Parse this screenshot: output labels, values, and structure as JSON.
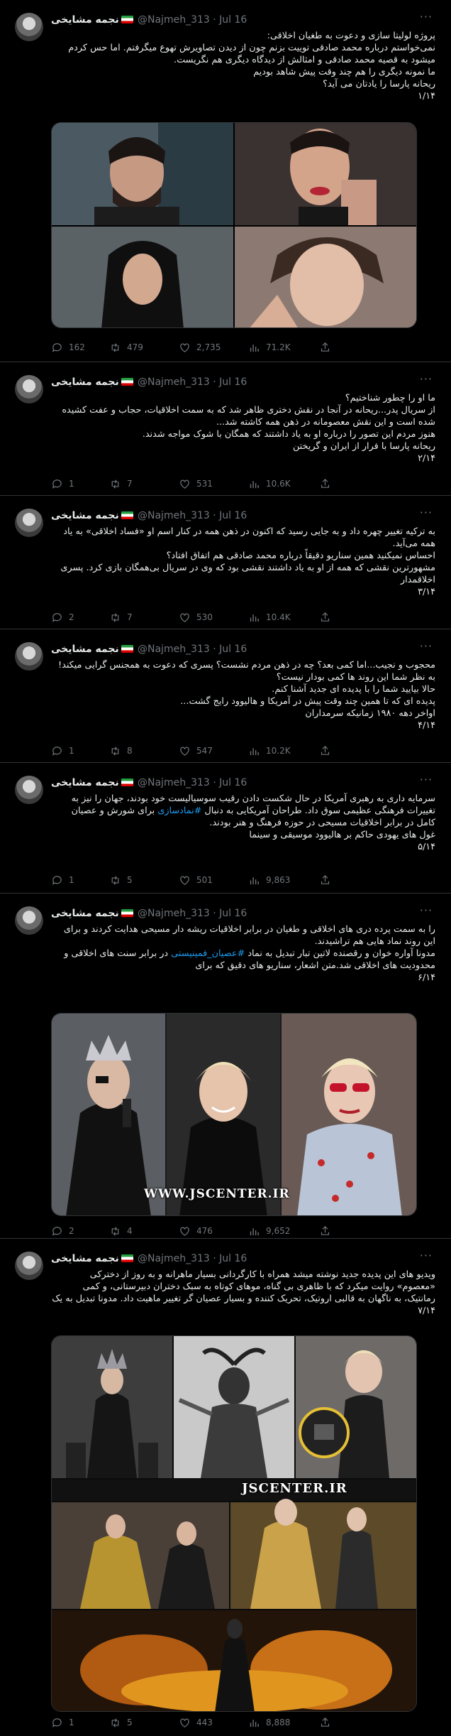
{
  "common": {
    "name": "نجمه مشایخی",
    "handle": "@Najmeh_313 · Jul 16"
  },
  "tweets": [
    {
      "text": "پروژه لولیتا سازی و دعوت به طغیان اخلاقی:\nنمی‌خواستم درباره محمد صادقی توییت بزنم چون از دیدن تصاویرش تهوع میگرفتم. اما حس کردم میشود به قصیه محمد صادقی و امثالش از دیدگاه دیگری هم نگریست.\nما نمونه دیگری را هم چند وقت پیش شاهد بودیم\nریحانه پارسا را یادتان می آید؟\n۱/۱۴",
      "stats": {
        "reply": "162",
        "retweet": "479",
        "like": "2,735",
        "views": "71.2K"
      }
    },
    {
      "text": "ما او را چطور شناختیم؟\nاز سریال پدر...ریحانه در آنجا در نقش دختری ظاهر شد که به سمت اخلاقیات، حجاب و عفت کشیده شده است و این نقش معصومانه در ذهن همه کاشته شد...\nهنوز مردم این تصور را درباره او به یاد داشتند که همگان با شوک مواجه شدند.\nریحانه پارسا با فرار از ایران و گریختن\n۲/۱۴",
      "stats": {
        "reply": "1",
        "retweet": "7",
        "like": "531",
        "views": "10.6K"
      }
    },
    {
      "text": "به ترکیه تغییر چهره داد و به جایی رسید که اکنون در ذهن همه در کنار اسم او «فساد اخلاقی» به یاد همه می‌آید.\nاحساس نمیکنید همین سناریو دقیقاً درباره محمد صادقی هم اتفاق افتاد؟\nمشهورترین نقشی که همه از او به یاد داشتند نقشی بود که وی در سریال بی‌همگان بازی کرد. پسری اخلاقمدار\n۳/۱۴",
      "stats": {
        "reply": "2",
        "retweet": "7",
        "like": "530",
        "views": "10.4K"
      }
    },
    {
      "text": "محجوب و نجیب...اما کمی بعد؟ چه در ذهن مردم نشست؟ پسری که دعوت به همجنس گرایی میکند!\nبه نظر شما این روند ها کمی بودار نیست؟\nحالا بیایید شما را با پدیده ای جدید آشنا کنم.\nپدیده ای که تا همین چند وقت پیش در آمریکا و هالیوود رایج گشت...\nاواخر دهه ۱۹۸۰ زمانیکه سرمداران\n۴/۱۴",
      "stats": {
        "reply": "1",
        "retweet": "8",
        "like": "547",
        "views": "10.2K"
      }
    },
    {
      "text_before": "سرمایه داری به رهبری آمریکا در حال شکست دادن رقیب سوسیالیست خود بودند، جهان را نیز به تغییرات فرهنگی عظیمی سوق داد. طراحان آمریکایی به دنبال ",
      "hashtag": "#نمادسازی",
      "text_after": " برای شورش و عصیان کامل در برابر اخلاقیات مسیحی در حوزه فرهنگ و هنر بودند.\nغول های یهودی حاکم بر هالیوود موسیقی و سینما\n۵/۱۴",
      "stats": {
        "reply": "1",
        "retweet": "5",
        "like": "501",
        "views": "9,863"
      }
    },
    {
      "text_before": "را به سمت پرده دری های اخلاقی و طغیان در برابر اخلاقیات ریشه دار مسیحی هدایت کردند و برای این روند نماد هایی هم تراشیدند.\nمدونا آواره خوان و رقصنده لاتین تبار تبدیل به نماد ",
      "hashtag": "#عصیان_فمینیستی",
      "text_after": " در برابر سنت های اخلاقی و محدودیت های اخلاقی شد.متن اشعار، سناریو های دقیق که برای\n۶/۱۴",
      "stats": {
        "reply": "2",
        "retweet": "4",
        "like": "476",
        "views": "9,652"
      },
      "watermark": "WWW.JSCENTER.IR"
    },
    {
      "text": "ویدیو های این پدیده جدید نوشته میشد همراه با کارگردانی بسیار ماهرانه و به روز از دخترکی «معصوم» روایت میکرد که با ظاهری بی گناه، موهای کوتاه به سبک دختران دبیرستانی، و کمی رمانتیک، به ناگهان به قالبی اروتیک، تحریک کننده و بسیار عصیان گر تغییر ماهیت داد. مدونا تبدیل به یک\n۷/۱۴",
      "stats": {
        "reply": "1",
        "retweet": "5",
        "like": "443",
        "views": "8,888"
      },
      "watermark": "JSCENTER.IR"
    }
  ],
  "colors": {
    "background": "#000000",
    "text": "#e7e9ea",
    "muted": "#71767b",
    "link": "#1d9bf0",
    "border": "#2f3336"
  },
  "icons": [
    "reply-icon",
    "retweet-icon",
    "like-icon",
    "views-icon",
    "share-icon",
    "more-icon",
    "iran-flag-icon"
  ]
}
